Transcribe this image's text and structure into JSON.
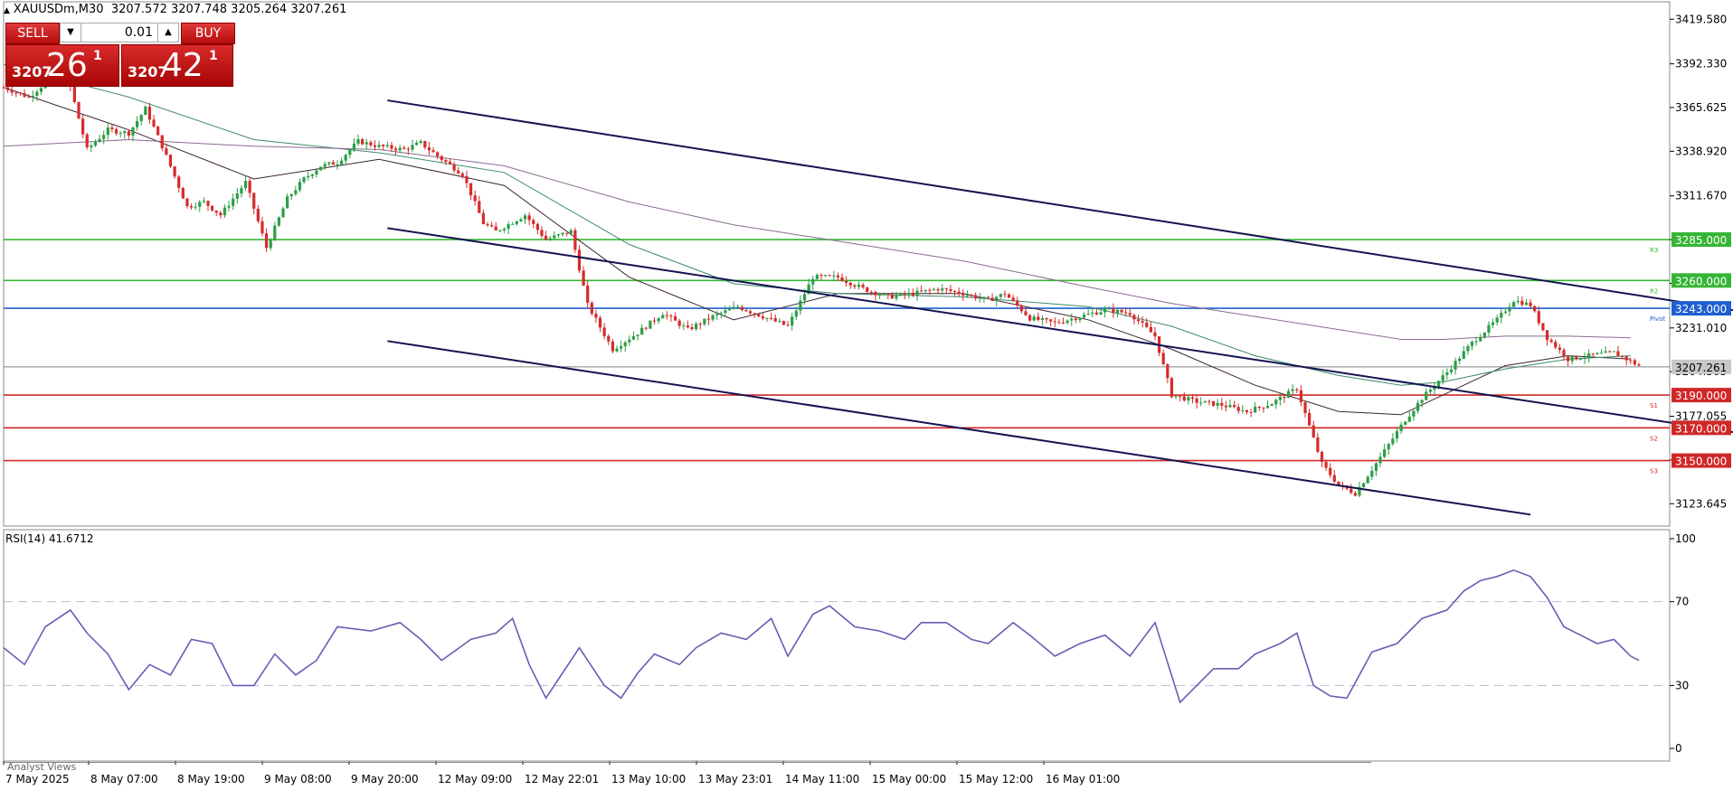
{
  "header": {
    "symbol": "XAUUSDm,M30",
    "ohlc": "3207.572 3207.748 3205.264 3207.261"
  },
  "trade_panel": {
    "sell_label": "SELL",
    "buy_label": "BUY",
    "lot": "0.01",
    "sell_small": "3207",
    "sell_big": "26",
    "sell_sup": "1",
    "buy_small": "3207",
    "buy_big": "42",
    "buy_sup": "1"
  },
  "bottom_tab": "Analyst Views",
  "colors": {
    "bull": "#2e9e48",
    "bear": "#d62c2c",
    "ma1": "#3b2530",
    "ma2": "#3e8a6a",
    "ma3": "#8a6a90",
    "channel": "#141450",
    "pivot": "#1f5fd0",
    "resistance": "#35b535",
    "support": "#d02828",
    "rsi": "#6b5bb5",
    "current": "#808080"
  },
  "chart_data": [
    {
      "type": "candlestick",
      "symbol": "XAUUSDm",
      "timeframe": "M30",
      "x_ticks": [
        "7 May 2025",
        "8 May 07:00",
        "8 May 19:00",
        "9 May 08:00",
        "9 May 20:00",
        "12 May 09:00",
        "12 May 22:01",
        "13 May 10:00",
        "13 May 23:01",
        "14 May 11:00",
        "15 May 00:00",
        "15 May 12:00",
        "16 May 01:00"
      ],
      "y_ticks": [
        3419.58,
        3392.33,
        3365.625,
        3338.92,
        3311.67,
        3284.965,
        3258.26,
        3231.01,
        3204.305,
        3177.055,
        3150.35,
        3123.645
      ],
      "y_tick_labels": [
        "3419.580",
        "3392.330",
        "3365.625",
        "3338.920",
        "3311.670",
        "",
        "",
        "3231.010",
        "3204.305",
        "3177.055",
        "",
        "3123.645"
      ],
      "ylim": [
        3110.0,
        3428.0
      ],
      "close_path": [
        [
          0,
          3378
        ],
        [
          6,
          3372
        ],
        [
          12,
          3385
        ],
        [
          16,
          3378
        ],
        [
          20,
          3340
        ],
        [
          25,
          3352
        ],
        [
          30,
          3350
        ],
        [
          34,
          3365
        ],
        [
          38,
          3342
        ],
        [
          44,
          3305
        ],
        [
          48,
          3308
        ],
        [
          52,
          3300
        ],
        [
          58,
          3320
        ],
        [
          63,
          3280
        ],
        [
          68,
          3310
        ],
        [
          72,
          3322
        ],
        [
          76,
          3330
        ],
        [
          80,
          3332
        ],
        [
          85,
          3345
        ],
        [
          90,
          3342
        ],
        [
          96,
          3340
        ],
        [
          100,
          3344
        ],
        [
          104,
          3336
        ],
        [
          110,
          3325
        ],
        [
          115,
          3295
        ],
        [
          118,
          3290
        ],
        [
          125,
          3300
        ],
        [
          130,
          3285
        ],
        [
          136,
          3290
        ],
        [
          140,
          3245
        ],
        [
          146,
          3218
        ],
        [
          152,
          3228
        ],
        [
          158,
          3240
        ],
        [
          164,
          3230
        ],
        [
          170,
          3238
        ],
        [
          176,
          3244
        ],
        [
          182,
          3238
        ],
        [
          188,
          3232
        ],
        [
          194,
          3262
        ],
        [
          200,
          3262
        ],
        [
          206,
          3255
        ],
        [
          212,
          3250
        ],
        [
          218,
          3252
        ],
        [
          224,
          3255
        ],
        [
          230,
          3252
        ],
        [
          236,
          3248
        ],
        [
          240,
          3252
        ],
        [
          246,
          3237
        ],
        [
          252,
          3234
        ],
        [
          258,
          3238
        ],
        [
          264,
          3242
        ],
        [
          270,
          3240
        ],
        [
          276,
          3226
        ],
        [
          280,
          3190
        ],
        [
          286,
          3186
        ],
        [
          292,
          3184
        ],
        [
          298,
          3180
        ],
        [
          304,
          3185
        ],
        [
          310,
          3194
        ],
        [
          316,
          3148
        ],
        [
          320,
          3135
        ],
        [
          324,
          3130
        ],
        [
          330,
          3152
        ],
        [
          336,
          3175
        ],
        [
          340,
          3188
        ],
        [
          346,
          3204
        ],
        [
          352,
          3222
        ],
        [
          358,
          3236
        ],
        [
          362,
          3248
        ],
        [
          366,
          3245
        ],
        [
          370,
          3225
        ],
        [
          375,
          3212
        ],
        [
          380,
          3214
        ],
        [
          386,
          3216
        ],
        [
          392,
          3208
        ]
      ],
      "bar_count": 392,
      "moving_averages": [
        {
          "values": [
            [
              0,
              3378
            ],
            [
              30,
              3352
            ],
            [
              60,
              3322
            ],
            [
              90,
              3334
            ],
            [
              120,
              3318
            ],
            [
              150,
              3262
            ],
            [
              175,
              3236
            ],
            [
              200,
              3252
            ],
            [
              230,
              3252
            ],
            [
              260,
              3236
            ],
            [
              280,
              3218
            ],
            [
              300,
              3196
            ],
            [
              320,
              3180
            ],
            [
              335,
              3178
            ],
            [
              345,
              3190
            ],
            [
              360,
              3208
            ],
            [
              375,
              3214
            ],
            [
              390,
              3212
            ]
          ]
        },
        {
          "values": [
            [
              0,
              3392
            ],
            [
              30,
              3372
            ],
            [
              60,
              3346
            ],
            [
              90,
              3338
            ],
            [
              120,
              3326
            ],
            [
              150,
              3282
            ],
            [
              175,
              3258
            ],
            [
              200,
              3252
            ],
            [
              230,
              3250
            ],
            [
              260,
              3244
            ],
            [
              280,
              3232
            ],
            [
              300,
              3214
            ],
            [
              320,
              3202
            ],
            [
              335,
              3196
            ],
            [
              345,
              3198
            ],
            [
              360,
              3206
            ],
            [
              375,
              3212
            ],
            [
              390,
              3214
            ]
          ]
        },
        {
          "values": [
            [
              0,
              3342
            ],
            [
              30,
              3346
            ],
            [
              60,
              3342
            ],
            [
              90,
              3340
            ],
            [
              120,
              3330
            ],
            [
              150,
              3308
            ],
            [
              175,
              3294
            ],
            [
              200,
              3284
            ],
            [
              230,
              3272
            ],
            [
              260,
              3256
            ],
            [
              280,
              3246
            ],
            [
              300,
              3238
            ],
            [
              320,
              3230
            ],
            [
              335,
              3224
            ],
            [
              345,
              3224
            ],
            [
              360,
              3226
            ],
            [
              375,
              3226
            ],
            [
              390,
              3225
            ]
          ]
        }
      ],
      "channel_lines": [
        {
          "from": [
            92,
            3370
          ],
          "to": [
            588,
            3173
          ]
        },
        {
          "from": [
            92,
            3292
          ],
          "to": [
            545,
            3117
          ]
        },
        {
          "from": [
            92,
            3223
          ],
          "to": [
            366,
            3117
          ]
        }
      ],
      "levels": [
        {
          "value": 3285.0,
          "label": "3285.000",
          "tag": "R3",
          "kind": "resistance"
        },
        {
          "value": 3260.0,
          "label": "3260.000",
          "tag": "R2",
          "kind": "resistance"
        },
        {
          "value": 3243.0,
          "label": "3243.000",
          "tag": "Pivot",
          "kind": "pivot"
        },
        {
          "value": 3207.261,
          "label": "3207.261",
          "tag": "",
          "kind": "current"
        },
        {
          "value": 3190.0,
          "label": "3190.000",
          "tag": "S1",
          "kind": "support"
        },
        {
          "value": 3170.0,
          "label": "3170.000",
          "tag": "S2",
          "kind": "support"
        },
        {
          "value": 3150.0,
          "label": "3150.000",
          "tag": "S3",
          "kind": "support"
        }
      ]
    },
    {
      "type": "line",
      "title": "RSI(14) 41.6712",
      "y_ticks": [
        100,
        70,
        30,
        0
      ],
      "y_tick_labels": [
        "100",
        "70",
        "30",
        "0"
      ],
      "ylim": [
        0,
        100
      ],
      "levels": [
        70,
        30
      ],
      "series": [
        {
          "values": [
            [
              0,
              48
            ],
            [
              5,
              40
            ],
            [
              10,
              58
            ],
            [
              16,
              66
            ],
            [
              20,
              55
            ],
            [
              25,
              45
            ],
            [
              30,
              28
            ],
            [
              35,
              40
            ],
            [
              40,
              35
            ],
            [
              45,
              52
            ],
            [
              50,
              50
            ],
            [
              55,
              30
            ],
            [
              60,
              30
            ],
            [
              65,
              45
            ],
            [
              70,
              35
            ],
            [
              75,
              42
            ],
            [
              80,
              58
            ],
            [
              88,
              56
            ],
            [
              95,
              60
            ],
            [
              100,
              52
            ],
            [
              105,
              42
            ],
            [
              112,
              52
            ],
            [
              118,
              55
            ],
            [
              122,
              62
            ],
            [
              126,
              40
            ],
            [
              130,
              24
            ],
            [
              134,
              36
            ],
            [
              138,
              48
            ],
            [
              144,
              30
            ],
            [
              148,
              24
            ],
            [
              152,
              36
            ],
            [
              156,
              45
            ],
            [
              162,
              40
            ],
            [
              166,
              48
            ],
            [
              172,
              55
            ],
            [
              178,
              52
            ],
            [
              184,
              62
            ],
            [
              188,
              44
            ],
            [
              194,
              64
            ],
            [
              198,
              68
            ],
            [
              204,
              58
            ],
            [
              210,
              56
            ],
            [
              216,
              52
            ],
            [
              220,
              60
            ],
            [
              226,
              60
            ],
            [
              232,
              52
            ],
            [
              236,
              50
            ],
            [
              242,
              60
            ],
            [
              246,
              54
            ],
            [
              252,
              44
            ],
            [
              258,
              50
            ],
            [
              264,
              54
            ],
            [
              270,
              44
            ],
            [
              276,
              60
            ],
            [
              282,
              22
            ],
            [
              286,
              30
            ],
            [
              290,
              38
            ],
            [
              296,
              38
            ],
            [
              300,
              45
            ],
            [
              306,
              50
            ],
            [
              310,
              55
            ],
            [
              314,
              30
            ],
            [
              318,
              25
            ],
            [
              322,
              24
            ],
            [
              328,
              46
            ],
            [
              334,
              50
            ],
            [
              340,
              62
            ],
            [
              346,
              66
            ],
            [
              350,
              75
            ],
            [
              354,
              80
            ],
            [
              358,
              82
            ],
            [
              362,
              85
            ],
            [
              366,
              82
            ],
            [
              370,
              72
            ],
            [
              374,
              58
            ],
            [
              378,
              54
            ],
            [
              382,
              50
            ],
            [
              386,
              52
            ],
            [
              390,
              44
            ],
            [
              392,
              42
            ]
          ]
        }
      ]
    }
  ]
}
